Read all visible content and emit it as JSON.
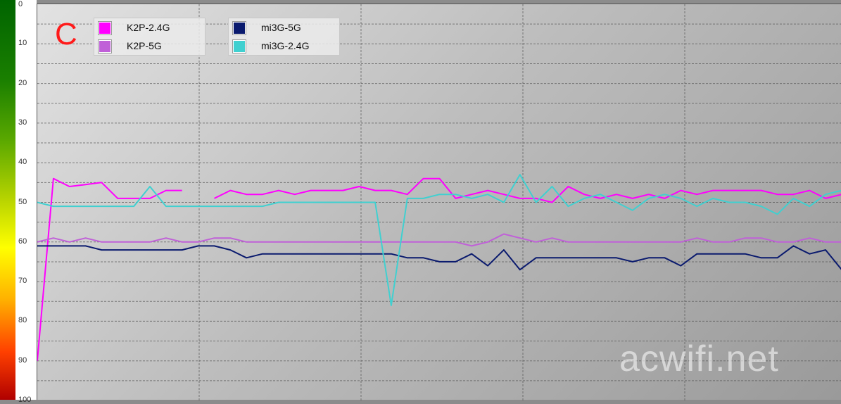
{
  "panel_label": "C",
  "watermark": "acwifi.net",
  "chart_data": {
    "type": "line",
    "title": "",
    "xlabel": "",
    "ylabel": "",
    "ylim": [
      0,
      100
    ],
    "y_inverted": true,
    "yticks": [
      "0",
      "10",
      "20",
      "30",
      "40",
      "50",
      "60",
      "70",
      "80",
      "90",
      "100"
    ],
    "grid": true,
    "legend_placement": "top-left",
    "legend": [
      {
        "name": "K2P-2.4G",
        "color": "#ff00ff"
      },
      {
        "name": "K2P-5G",
        "color": "#c060d8"
      },
      {
        "name": "mi3G-5G",
        "color": "#0a1a6e"
      },
      {
        "name": "mi3G-2.4G",
        "color": "#40d0d0"
      }
    ],
    "x": [
      0,
      1,
      2,
      3,
      4,
      5,
      6,
      7,
      8,
      9,
      10,
      11,
      12,
      13,
      14,
      15,
      16,
      17,
      18,
      19,
      20,
      21,
      22,
      23,
      24,
      25,
      26,
      27,
      28,
      29,
      30,
      31,
      32,
      33,
      34,
      35,
      36,
      37,
      38,
      39,
      40,
      41,
      42,
      43,
      44,
      45,
      46,
      47,
      48,
      49,
      50
    ],
    "series": [
      {
        "name": "K2P-2.4G",
        "color": "#ff00ff",
        "values": [
          90,
          44,
          46,
          45.5,
          45,
          49,
          49,
          49,
          47,
          47,
          null,
          49,
          47,
          48,
          48,
          47,
          48,
          47,
          47,
          47,
          46,
          47,
          47,
          48,
          44,
          44,
          49,
          48,
          47,
          48,
          49,
          49,
          50,
          46,
          48,
          49,
          48,
          49,
          48,
          49,
          47,
          48,
          47,
          47,
          47,
          47,
          48,
          48,
          47,
          49,
          48
        ]
      },
      {
        "name": "K2P-5G",
        "color": "#c060d8",
        "values": [
          60,
          59,
          60,
          59,
          60,
          60,
          60,
          60,
          59,
          60,
          60,
          59,
          59,
          60,
          60,
          60,
          60,
          60,
          60,
          60,
          60,
          60,
          60,
          60,
          60,
          60,
          60,
          61,
          60,
          58,
          59,
          60,
          59,
          60,
          60,
          60,
          60,
          60,
          60,
          60,
          60,
          59,
          60,
          60,
          59,
          59,
          60,
          60,
          59,
          60,
          60
        ]
      },
      {
        "name": "mi3G-5G",
        "color": "#0a1a6e",
        "values": [
          61,
          61,
          61,
          61,
          62,
          62,
          62,
          62,
          62,
          62,
          61,
          61,
          62,
          64,
          63,
          63,
          63,
          63,
          63,
          63,
          63,
          63,
          63,
          64,
          64,
          65,
          65,
          63,
          66,
          62,
          67,
          64,
          64,
          64,
          64,
          64,
          64,
          65,
          64,
          64,
          66,
          63,
          63,
          63,
          63,
          64,
          64,
          61,
          63,
          62,
          67
        ]
      },
      {
        "name": "mi3G-2.4G",
        "color": "#40d0d0",
        "values": [
          50,
          51,
          51,
          51,
          51,
          51,
          51,
          46,
          51,
          51,
          51,
          51,
          51,
          51,
          51,
          50,
          50,
          50,
          50,
          50,
          50,
          50,
          76,
          49,
          49,
          48,
          48,
          49,
          48,
          50,
          43,
          50,
          46,
          51,
          49,
          48,
          50,
          52,
          49,
          48,
          49,
          51,
          49,
          50,
          50,
          51,
          53,
          49,
          51,
          48,
          47
        ]
      }
    ]
  }
}
